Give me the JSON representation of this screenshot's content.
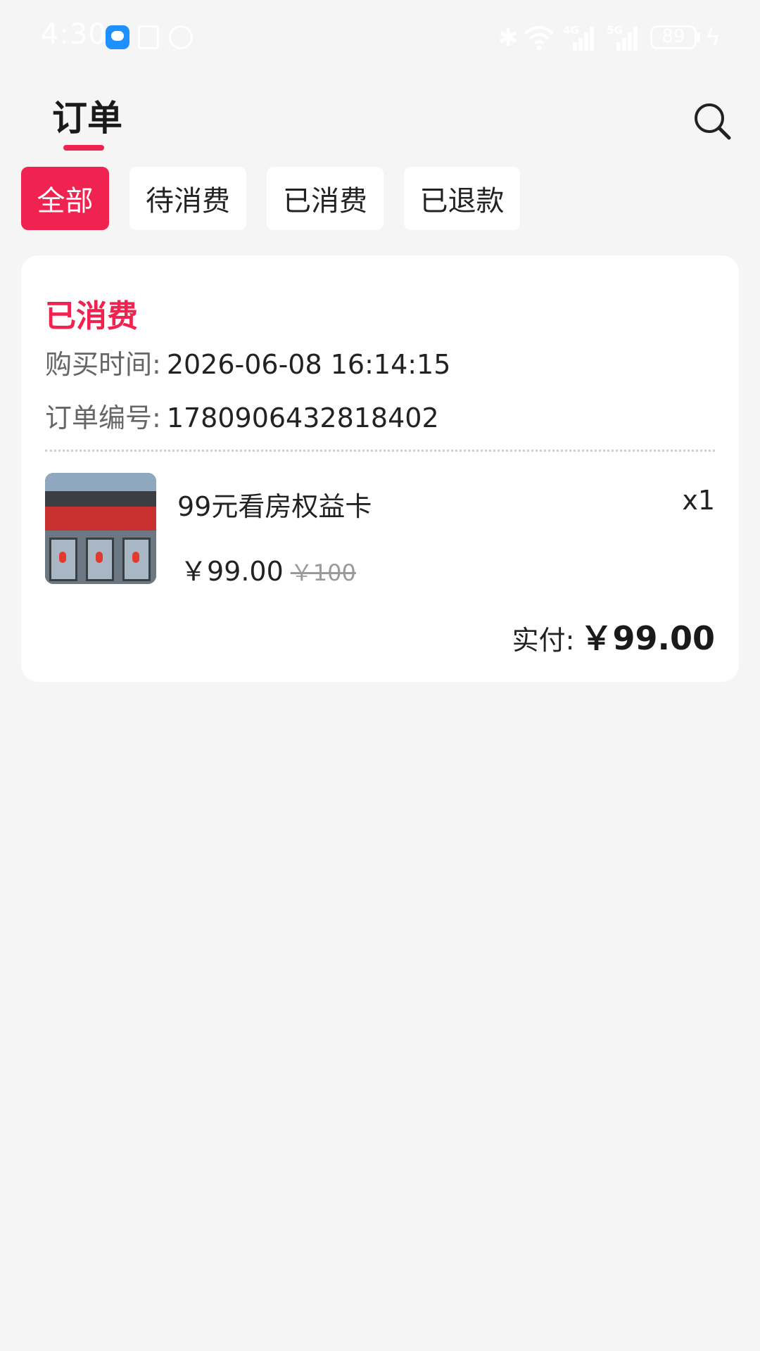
{
  "status_bar": {
    "time": "4:30",
    "signal_1": "4G",
    "signal_2": "5G",
    "battery": "89"
  },
  "header": {
    "title": "订单"
  },
  "tabs": [
    {
      "label": "全部",
      "active": true
    },
    {
      "label": "待消费",
      "active": false
    },
    {
      "label": "已消费",
      "active": false
    },
    {
      "label": "已退款",
      "active": false
    }
  ],
  "order": {
    "status": "已消费",
    "purchase_time_label": "购买时间:",
    "purchase_time": "2026-06-08 16:14:15",
    "order_no_label": "订单编号:",
    "order_no": "1780906432818402",
    "product_name": "99元看房权益卡",
    "quantity": "x1",
    "price": "￥99.00",
    "original_price": "￥100",
    "paid_label": "实付:",
    "paid_amount": "￥99.00"
  },
  "colors": {
    "accent": "#f0224f",
    "background": "#f5f5f5",
    "card": "#ffffff"
  },
  "icons": {
    "search": "search-icon",
    "product_thumbnail": "storefront-photo"
  }
}
